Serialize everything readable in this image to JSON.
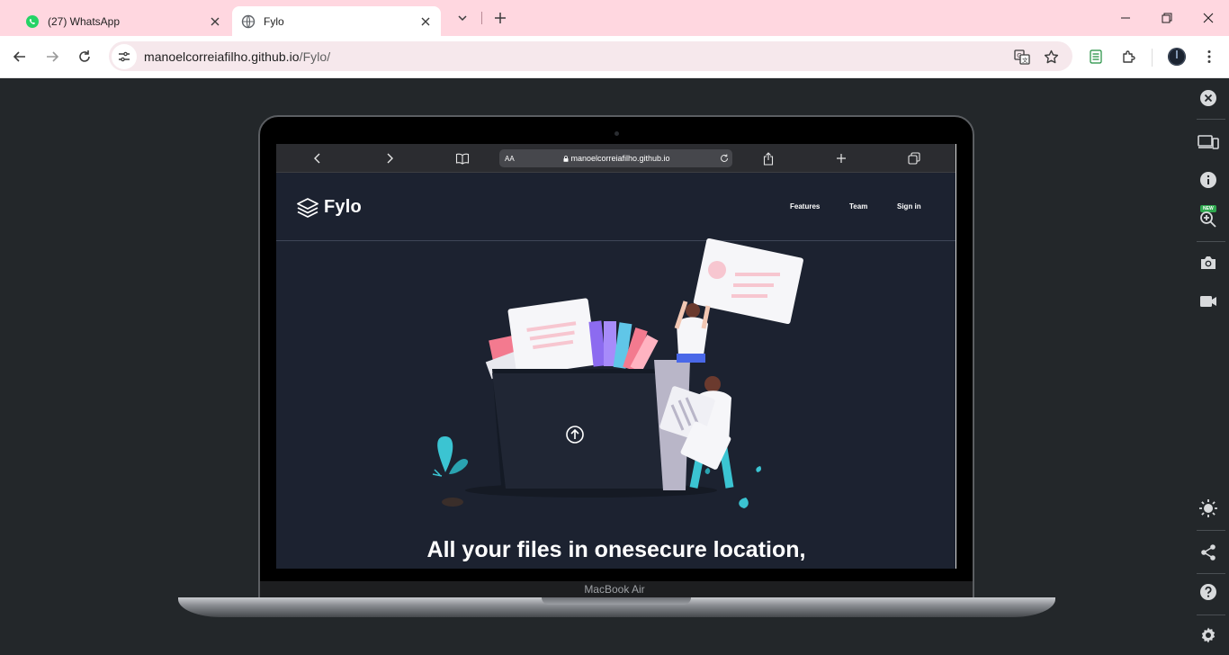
{
  "browser": {
    "tabs": [
      {
        "title": "(27) WhatsApp",
        "icon": "whatsapp-icon",
        "active": false
      },
      {
        "title": "Fylo",
        "icon": "globe-icon",
        "active": true
      }
    ],
    "address": {
      "host": "manoelcorreiafilho.github.io",
      "path": "/Fylo/"
    }
  },
  "device": {
    "model_label": "MacBook Air"
  },
  "safari": {
    "text_size_label": "AA",
    "host": "manoelcorreiafilho.github.io"
  },
  "fylo": {
    "brand": "Fylo",
    "nav": [
      "Features",
      "Team",
      "Sign in"
    ],
    "headline": "All your files in onesecure location,"
  },
  "side_panel": {
    "new_badge": "NEW",
    "tools": [
      "close-icon",
      "devices-icon",
      "info-icon",
      "zoom-in-icon",
      "camera-icon",
      "video-icon",
      "brightness-icon",
      "share-icon",
      "help-icon",
      "settings-icon"
    ]
  },
  "colors": {
    "tab_strip": "#ffd7e0",
    "omnibox": "#f6e8ec",
    "page_bg": "#23272a",
    "fylo_bg": "#1c2230",
    "accent_teal": "#3bc4d2",
    "accent_pink": "#f37a8f"
  }
}
